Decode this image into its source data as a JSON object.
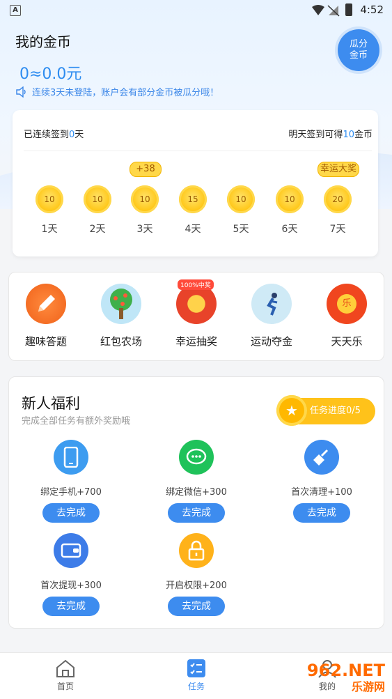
{
  "status": {
    "time": "4:52",
    "indicator": "A"
  },
  "header": {
    "title": "我的金币",
    "balance": "0≈0.0元",
    "notice": "连续3天未登陆，账户会有部分金币被瓜分哦！",
    "badge_line1": "瓜分",
    "badge_line2": "金币"
  },
  "sign": {
    "left_prefix": "已连续签到",
    "left_count": "0",
    "left_suffix": "天",
    "right_prefix": "明天签到可得",
    "right_count": "10",
    "right_suffix": "金币",
    "tag_bonus": "+38",
    "tag_prize": "幸运大奖",
    "days": [
      {
        "coin": "10",
        "label": "1天"
      },
      {
        "coin": "10",
        "label": "2天"
      },
      {
        "coin": "10",
        "label": "3天"
      },
      {
        "coin": "15",
        "label": "4天"
      },
      {
        "coin": "10",
        "label": "5天"
      },
      {
        "coin": "10",
        "label": "6天"
      },
      {
        "coin": "20",
        "label": "7天"
      }
    ]
  },
  "features": [
    {
      "label": "趣味答题",
      "icon": "pencil-icon"
    },
    {
      "label": "红包农场",
      "icon": "tree-icon"
    },
    {
      "label": "幸运抽奖",
      "icon": "wheel-icon",
      "badge": "100%中奖"
    },
    {
      "label": "运动夺金",
      "icon": "runner-icon"
    },
    {
      "label": "天天乐",
      "icon": "redpacket-icon",
      "glyph": "乐"
    }
  ],
  "newbie": {
    "title": "新人福利",
    "subtitle": "完成全部任务有额外奖励哦",
    "progress": "任务进度0/5",
    "tasks": [
      {
        "label": "绑定手机+700",
        "button": "去完成",
        "icon": "phone-icon",
        "color": "#3d9cf0"
      },
      {
        "label": "绑定微信+300",
        "button": "去完成",
        "icon": "wechat-icon",
        "color": "#1fc25a"
      },
      {
        "label": "首次清理+100",
        "button": "去完成",
        "icon": "broom-icon",
        "color": "#3d8cef"
      },
      {
        "label": "首次提现+300",
        "button": "去完成",
        "icon": "wallet-icon",
        "color": "#3d7ce8"
      },
      {
        "label": "开启权限+200",
        "button": "去完成",
        "icon": "lock-icon",
        "color": "#ffb21a"
      }
    ]
  },
  "tabs": [
    {
      "label": "首页",
      "icon": "home-icon"
    },
    {
      "label": "任务",
      "icon": "task-icon"
    },
    {
      "label": "我的",
      "icon": "user-icon"
    }
  ],
  "watermark": {
    "line1": "962.NET",
    "line2": "乐游网"
  },
  "colors": {
    "accent": "#3d8cef",
    "gold": "#ffc21a"
  }
}
